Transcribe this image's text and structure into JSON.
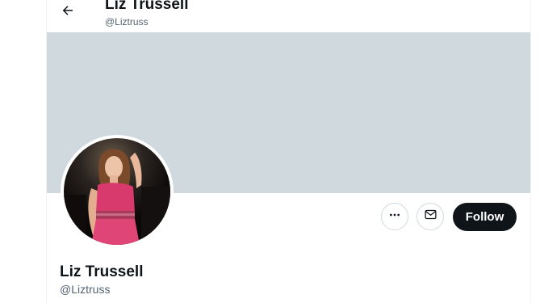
{
  "header": {
    "name": "Liz Trussell",
    "handle": "@Liztruss",
    "back_icon": "arrow-left-icon"
  },
  "banner": {
    "color": "#cfd9de"
  },
  "avatar": {
    "description_icon": "profile-photo"
  },
  "actions": {
    "more_icon": "more-horizontal-icon",
    "message_icon": "envelope-icon",
    "follow_label": "Follow"
  },
  "profile": {
    "name": "Liz Trussell",
    "handle": "@Liztruss"
  },
  "colors": {
    "text_primary": "#0f1419",
    "text_secondary": "#536471",
    "border": "#cfd9de",
    "follow_bg": "#0f1419",
    "follow_text": "#ffffff"
  }
}
